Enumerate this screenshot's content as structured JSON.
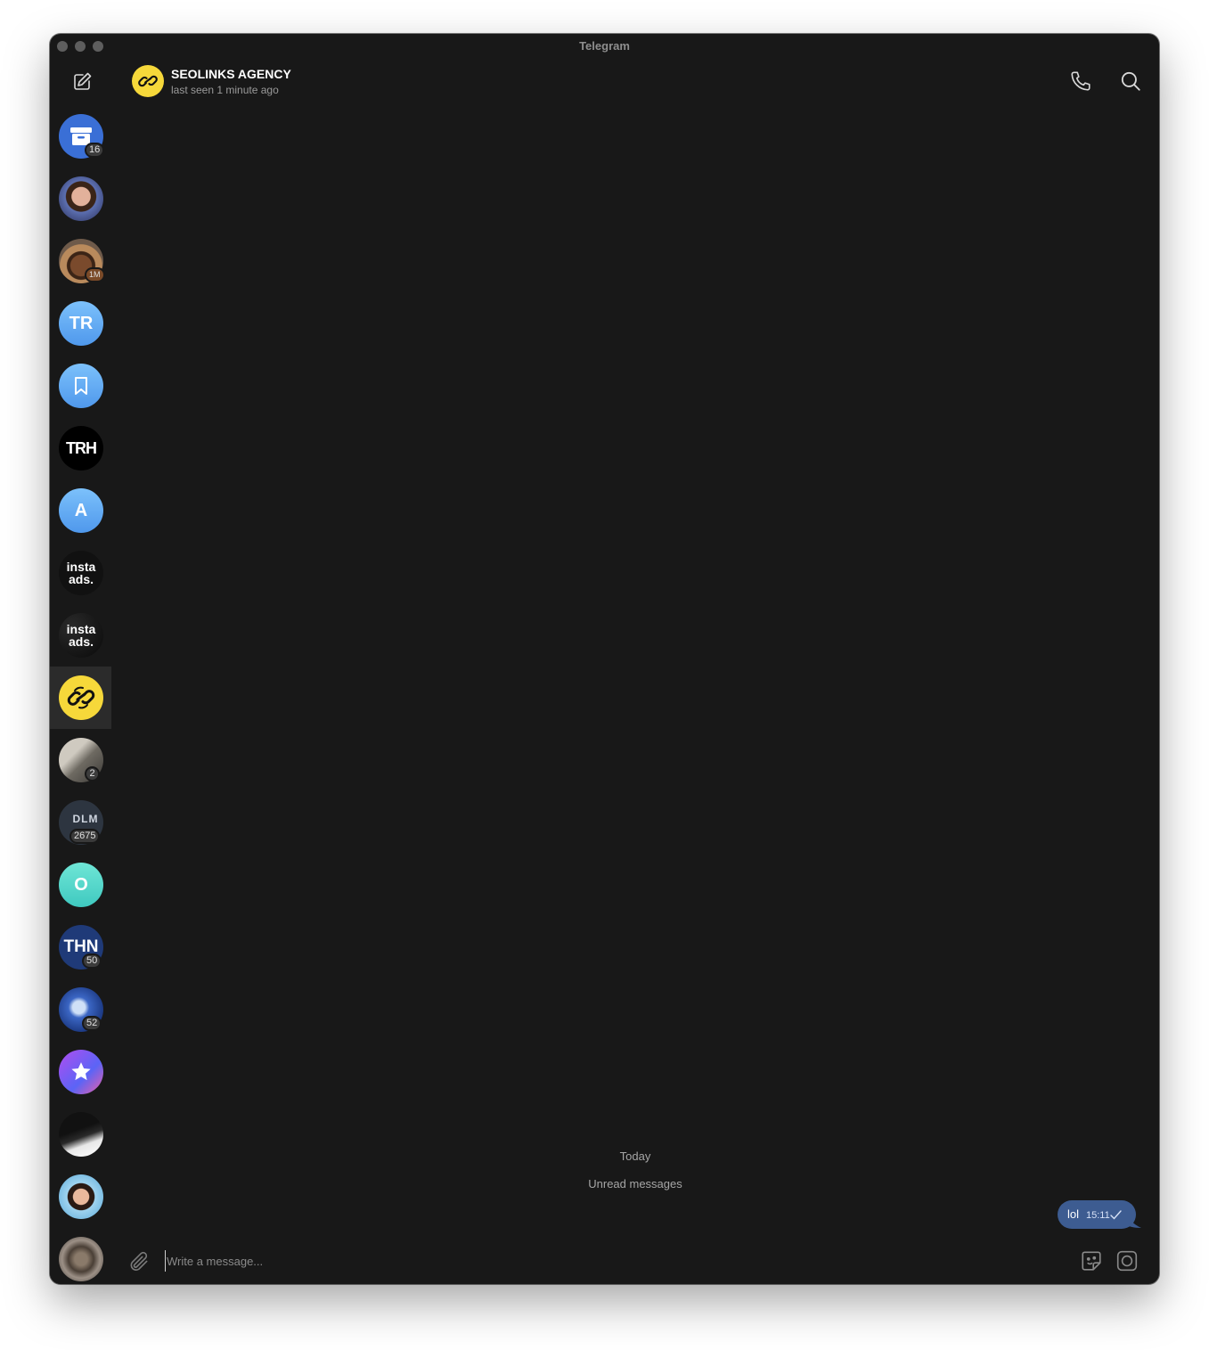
{
  "window": {
    "title": "Telegram"
  },
  "colors": {
    "background": "#181818",
    "bubble": "#3d5c91",
    "accent_yellow": "#f6d83a",
    "selected_row": "#2b2b2b"
  },
  "sidebar": {
    "compose_icon": "compose-icon",
    "chats": [
      {
        "name": "archive",
        "initials": "",
        "badge": "16",
        "icon": "archive-icon"
      },
      {
        "name": "woman-photo",
        "initials": "",
        "badge": ""
      },
      {
        "name": "cowboy-photo",
        "initials": "",
        "badge": "1M"
      },
      {
        "name": "tr",
        "initials": "TR",
        "badge": ""
      },
      {
        "name": "saved-messages",
        "initials": "",
        "badge": "",
        "icon": "bookmark-icon"
      },
      {
        "name": "trh",
        "initials": "TRH",
        "badge": ""
      },
      {
        "name": "a",
        "initials": "A",
        "badge": ""
      },
      {
        "name": "instaads-1",
        "logo_text": "insta ads.",
        "badge": ""
      },
      {
        "name": "instaads-2",
        "logo_text": "insta ads.",
        "badge": ""
      },
      {
        "name": "seolinks",
        "initials": "",
        "badge": "",
        "icon": "chain-link-icon",
        "selected": true
      },
      {
        "name": "photo-gray",
        "initials": "",
        "badge": "2"
      },
      {
        "name": "dlm",
        "logo_text": "DLM",
        "badge": "2675"
      },
      {
        "name": "o",
        "initials": "O",
        "badge": ""
      },
      {
        "name": "thn",
        "initials": "THN",
        "badge": "50"
      },
      {
        "name": "blue-photo",
        "initials": "",
        "badge": "52"
      },
      {
        "name": "star-bot",
        "initials": "",
        "badge": "",
        "icon": "star-icon"
      },
      {
        "name": "hacker-photo",
        "initials": "",
        "badge": ""
      },
      {
        "name": "woman-photo-2",
        "initials": "",
        "badge": ""
      },
      {
        "name": "werewolf-photo",
        "initials": "",
        "badge": ""
      }
    ]
  },
  "header": {
    "name": "SEOLINKS AGENCY",
    "status": "last seen 1 minute ago",
    "icons": [
      "phone-icon",
      "search-icon",
      "more-icon"
    ]
  },
  "messages": {
    "date_separator": "Today",
    "unread_separator": "Unread messages",
    "items": [
      {
        "text": "lol",
        "time": "15:11",
        "outgoing": true,
        "status": "sent"
      }
    ]
  },
  "composer": {
    "placeholder": "Write a message...",
    "value": "",
    "icons": [
      "attach-icon",
      "sticker-icon",
      "camera-icon"
    ]
  }
}
